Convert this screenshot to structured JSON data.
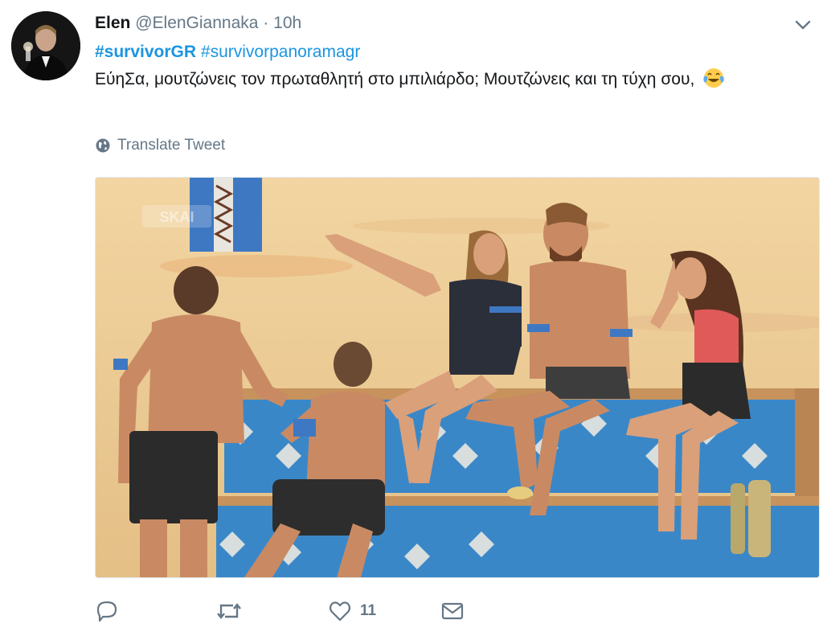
{
  "author": {
    "name": "Elen",
    "handle": "@ElenGiannaka",
    "separator": "·",
    "time": "10h",
    "avatar_icon": "avatar-photo"
  },
  "tweet": {
    "hashtag_1": "#survivorGR",
    "hashtag_2": "#survivorpanoramagr",
    "body_line": "ΕύηΣα, μουτζώνεις τον πρωταθλητή στο μπιλιάρδο; Μουτζώνεις και τη τύχη σου,",
    "emoji_icon": "tears-of-joy-emoji"
  },
  "translate": {
    "label": "Translate Tweet",
    "icon": "globe-icon"
  },
  "media": {
    "watermark": "SKAI"
  },
  "actions": {
    "reply_icon": "reply-icon",
    "retweet_icon": "retweet-icon",
    "like_icon": "heart-icon",
    "like_count": "11",
    "message_icon": "envelope-icon"
  },
  "colors": {
    "link": "#1b95e0",
    "muted": "#657786",
    "text": "#14171a"
  }
}
